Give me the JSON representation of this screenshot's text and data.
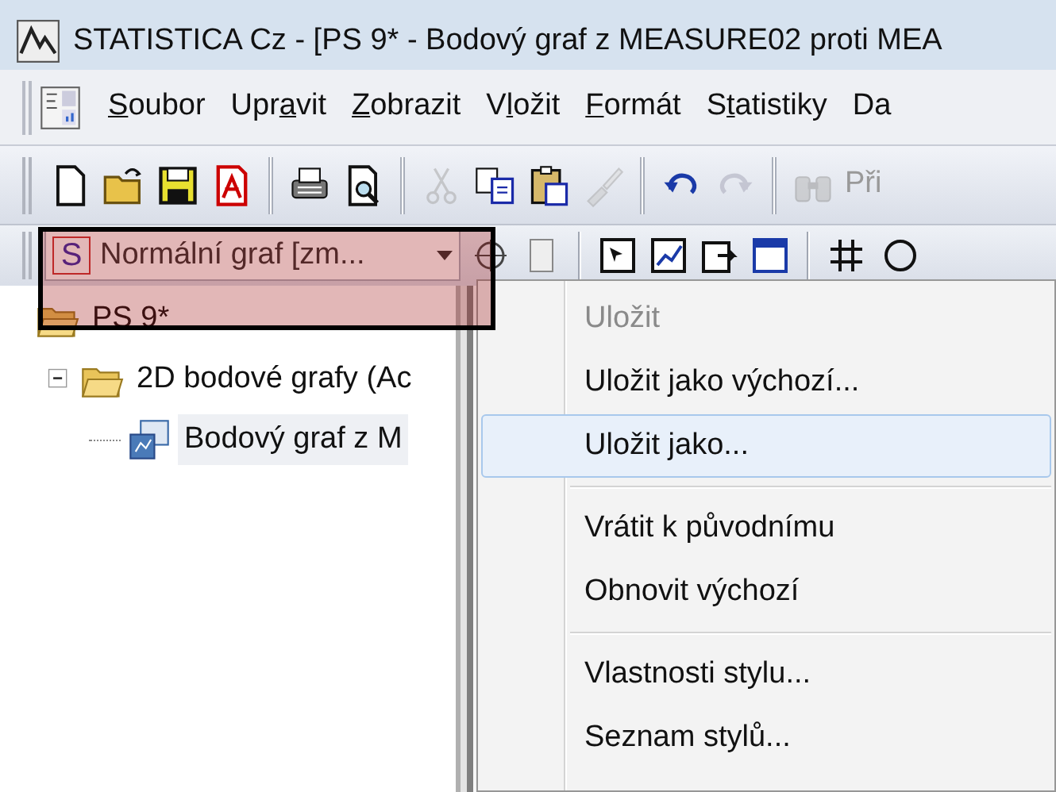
{
  "window": {
    "title": "STATISTICA Cz - [PS 9* - Bodový graf z MEASURE02 proti MEA"
  },
  "menu_bar": [
    {
      "key": "S",
      "post": "oubor"
    },
    {
      "pre": "Upr",
      "key": "a",
      "post": "vit"
    },
    {
      "key": "Z",
      "post": "obrazit"
    },
    {
      "pre": "V",
      "key": "l",
      "post": "ožit"
    },
    {
      "key": "F",
      "post": "ormát"
    },
    {
      "pre": "S",
      "key": "t",
      "post": "atistiky"
    },
    {
      "pre": "Da"
    }
  ],
  "toolbar": [
    {
      "kind": "new",
      "disabled": false
    },
    {
      "kind": "open",
      "disabled": false
    },
    {
      "kind": "save",
      "disabled": false
    },
    {
      "kind": "pdf",
      "disabled": false
    },
    {
      "kind": "separator"
    },
    {
      "kind": "print",
      "disabled": false
    },
    {
      "kind": "preview",
      "disabled": false
    },
    {
      "kind": "separator"
    },
    {
      "kind": "cut",
      "disabled": true
    },
    {
      "kind": "copy",
      "disabled": false
    },
    {
      "kind": "paste",
      "disabled": false
    },
    {
      "kind": "brush",
      "disabled": true
    },
    {
      "kind": "separator"
    },
    {
      "kind": "undo",
      "disabled": false
    },
    {
      "kind": "redo",
      "disabled": true
    },
    {
      "kind": "separator"
    },
    {
      "kind": "find",
      "disabled": true,
      "label": "Při"
    }
  ],
  "style_toolbar": {
    "style_combo": {
      "icon_letter": "S",
      "value": "Normální graf [zm..."
    },
    "tools": [
      {
        "kind": "target"
      },
      {
        "kind": "page"
      },
      {
        "kind": "separator"
      },
      {
        "kind": "select"
      },
      {
        "kind": "chart"
      },
      {
        "kind": "export"
      },
      {
        "kind": "window"
      },
      {
        "kind": "separator"
      },
      {
        "kind": "grid"
      },
      {
        "kind": "circle"
      }
    ]
  },
  "tree": [
    {
      "label": "PS 9*",
      "expanded": true,
      "selected": false,
      "children": [
        {
          "label": "2D bodové grafy (Ac",
          "expanded": true,
          "selected": false,
          "children": [
            {
              "label": "Bodový graf z M",
              "selected": true
            }
          ]
        }
      ]
    }
  ],
  "context_menu": [
    {
      "kind": "item",
      "label": "Uložit",
      "disabled": true,
      "selected": false
    },
    {
      "kind": "item",
      "label": "Uložit jako výchozí...",
      "disabled": false,
      "selected": false
    },
    {
      "kind": "item",
      "label": "Uložit jako...",
      "disabled": false,
      "selected": true
    },
    {
      "kind": "separator"
    },
    {
      "kind": "item",
      "label": "Vrátit k původnímu",
      "disabled": false,
      "selected": false
    },
    {
      "kind": "item",
      "label": "Obnovit výchozí",
      "disabled": false,
      "selected": false
    },
    {
      "kind": "separator"
    },
    {
      "kind": "item",
      "label": "Vlastnosti stylu...",
      "disabled": false,
      "selected": false
    },
    {
      "kind": "item",
      "label": "Seznam stylů...",
      "disabled": false,
      "selected": false
    }
  ]
}
